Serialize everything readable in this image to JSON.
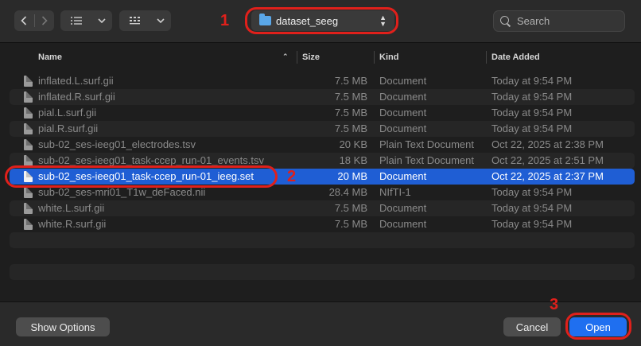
{
  "toolbar": {
    "location": "dataset_seeg",
    "search_placeholder": "Search"
  },
  "columns": {
    "name": "Name",
    "size": "Size",
    "kind": "Kind",
    "date": "Date Added"
  },
  "files": [
    {
      "name": "inflated.L.surf.gii",
      "size": "7.5 MB",
      "kind": "Document",
      "date": "Today at 9:54 PM"
    },
    {
      "name": "inflated.R.surf.gii",
      "size": "7.5 MB",
      "kind": "Document",
      "date": "Today at 9:54 PM"
    },
    {
      "name": "pial.L.surf.gii",
      "size": "7.5 MB",
      "kind": "Document",
      "date": "Today at 9:54 PM"
    },
    {
      "name": "pial.R.surf.gii",
      "size": "7.5 MB",
      "kind": "Document",
      "date": "Today at 9:54 PM"
    },
    {
      "name": "sub-02_ses-ieeg01_electrodes.tsv",
      "size": "20 KB",
      "kind": "Plain Text Document",
      "date": "Oct 22, 2025 at 2:38 PM"
    },
    {
      "name": "sub-02_ses-ieeg01_task-ccep_run-01_events.tsv",
      "size": "18 KB",
      "kind": "Plain Text Document",
      "date": "Oct 22, 2025 at 2:51 PM"
    },
    {
      "name": "sub-02_ses-ieeg01_task-ccep_run-01_ieeg.set",
      "size": "20 MB",
      "kind": "Document",
      "date": "Oct 22, 2025 at 2:37 PM",
      "selected": true
    },
    {
      "name": "sub-02_ses-mri01_T1w_deFaced.nii",
      "size": "28.4 MB",
      "kind": "NIfTI-1",
      "date": "Today at 9:54 PM"
    },
    {
      "name": "white.L.surf.gii",
      "size": "7.5 MB",
      "kind": "Document",
      "date": "Today at 9:54 PM"
    },
    {
      "name": "white.R.surf.gii",
      "size": "7.5 MB",
      "kind": "Document",
      "date": "Today at 9:54 PM"
    }
  ],
  "footer": {
    "show_options": "Show Options",
    "cancel": "Cancel",
    "open": "Open"
  },
  "annotations": [
    "1",
    "2",
    "3"
  ],
  "colors": {
    "accent": "#1f6ff0",
    "selection": "#1f5ed4",
    "annotation": "#e0201b"
  }
}
